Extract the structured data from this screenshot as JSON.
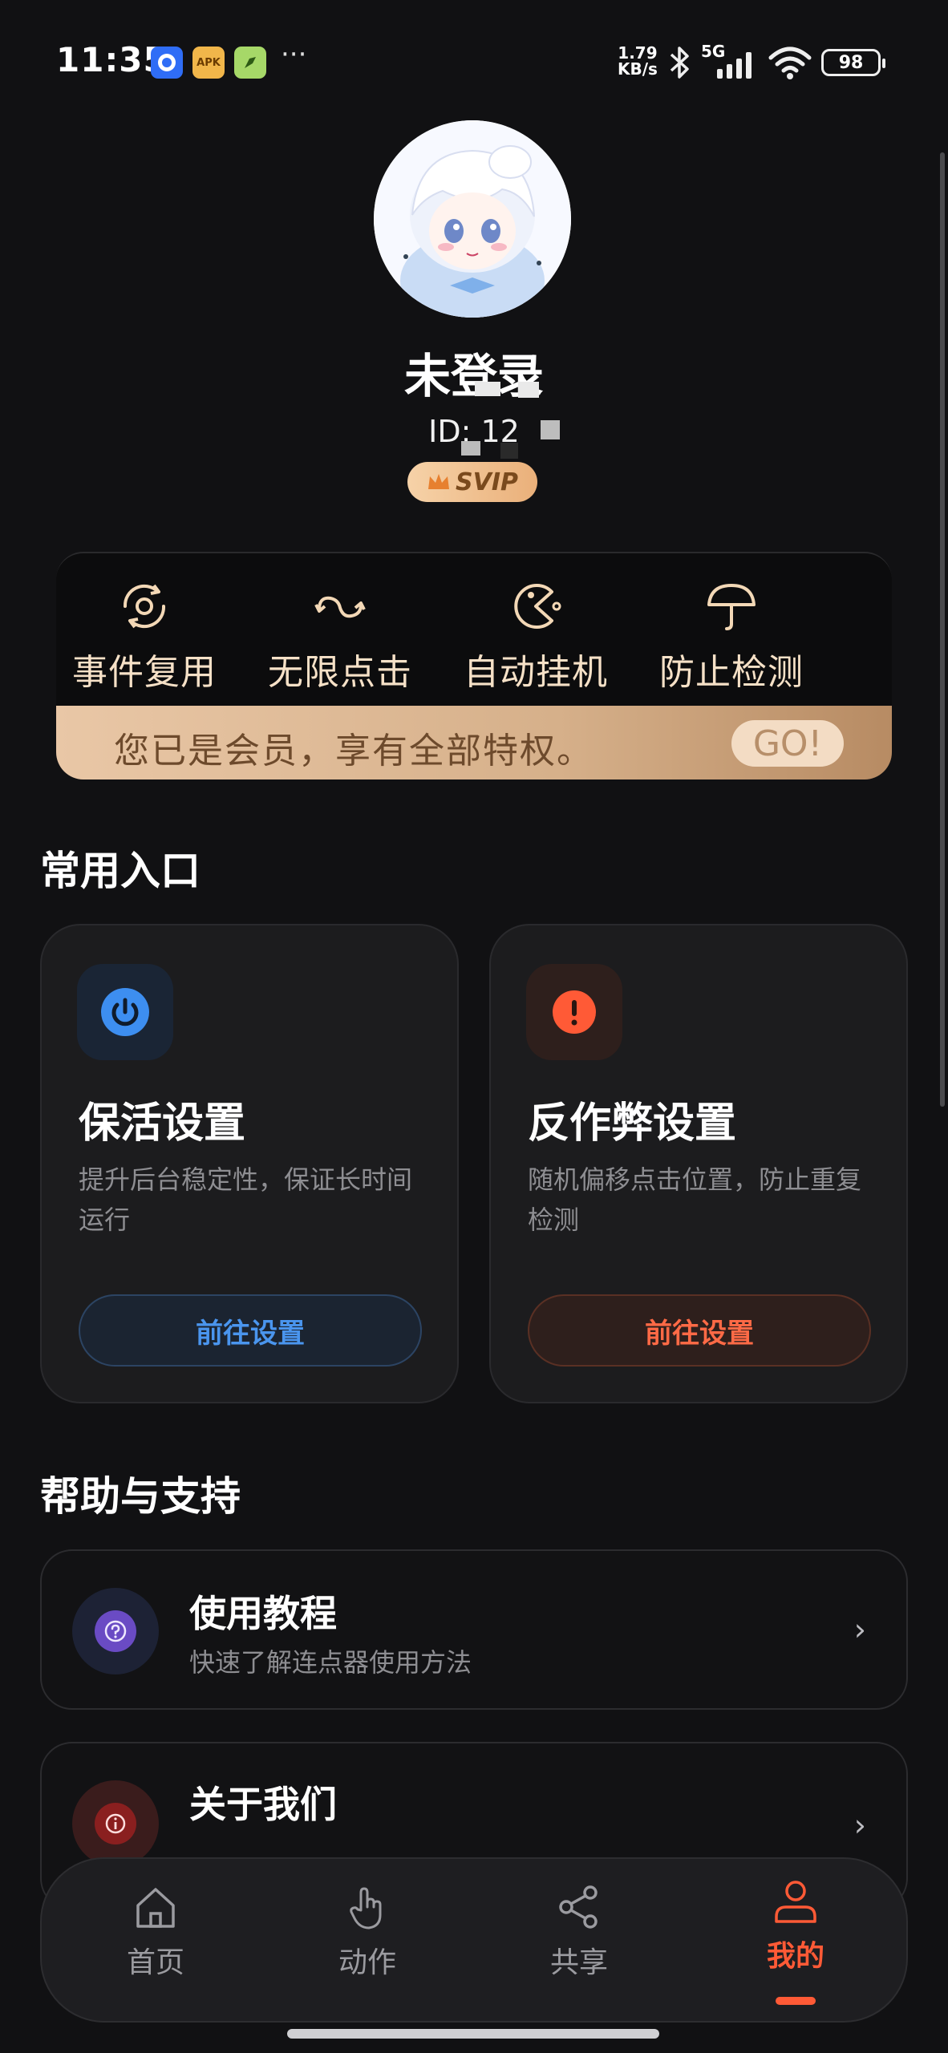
{
  "status_bar": {
    "time": "11:35",
    "app_icons": [
      "blue-app-icon",
      "apk-app-icon",
      "green-app-icon"
    ],
    "apk_label": "APK",
    "more": "···",
    "net_speed_value": "1.79",
    "net_speed_unit": "KB/s",
    "network_type": "5G",
    "battery": "98"
  },
  "profile": {
    "status": "未登录",
    "user_id": "ID: 12",
    "badge": "SVIP"
  },
  "vip_card": {
    "features": [
      {
        "label": "事件复用",
        "icon": "recycle-ring-icon"
      },
      {
        "label": "无限点击",
        "icon": "infinite-loop-icon"
      },
      {
        "label": "自动挂机",
        "icon": "pacman-icon"
      },
      {
        "label": "防止检测",
        "icon": "umbrella-icon"
      }
    ],
    "banner_text": "您已是会员，享有全部特权。",
    "go_label": "GO!"
  },
  "common_entries": {
    "title": "常用入口",
    "cards": [
      {
        "title": "保活设置",
        "desc": "提升后台稳定性，保证长时间运行",
        "button": "前往设置",
        "icon": "power-icon",
        "accent": "#3d8ef0"
      },
      {
        "title": "反作弊设置",
        "desc": "随机偏移点击位置，防止重复检测",
        "button": "前往设置",
        "icon": "alert-icon",
        "accent": "#ff5a36"
      }
    ]
  },
  "help": {
    "title": "帮助与支持",
    "items": [
      {
        "title": "使用教程",
        "subtitle": "快速了解连点器使用方法",
        "icon": "question-icon"
      },
      {
        "title": "关于我们",
        "icon": "info-icon"
      }
    ]
  },
  "bottom_nav": {
    "items": [
      {
        "label": "首页",
        "icon": "home-icon",
        "active": false
      },
      {
        "label": "动作",
        "icon": "tap-hand-icon",
        "active": false
      },
      {
        "label": "共享",
        "icon": "share-icon",
        "active": false
      },
      {
        "label": "我的",
        "icon": "user-icon",
        "active": true
      }
    ],
    "active_color": "#ff5a36"
  }
}
